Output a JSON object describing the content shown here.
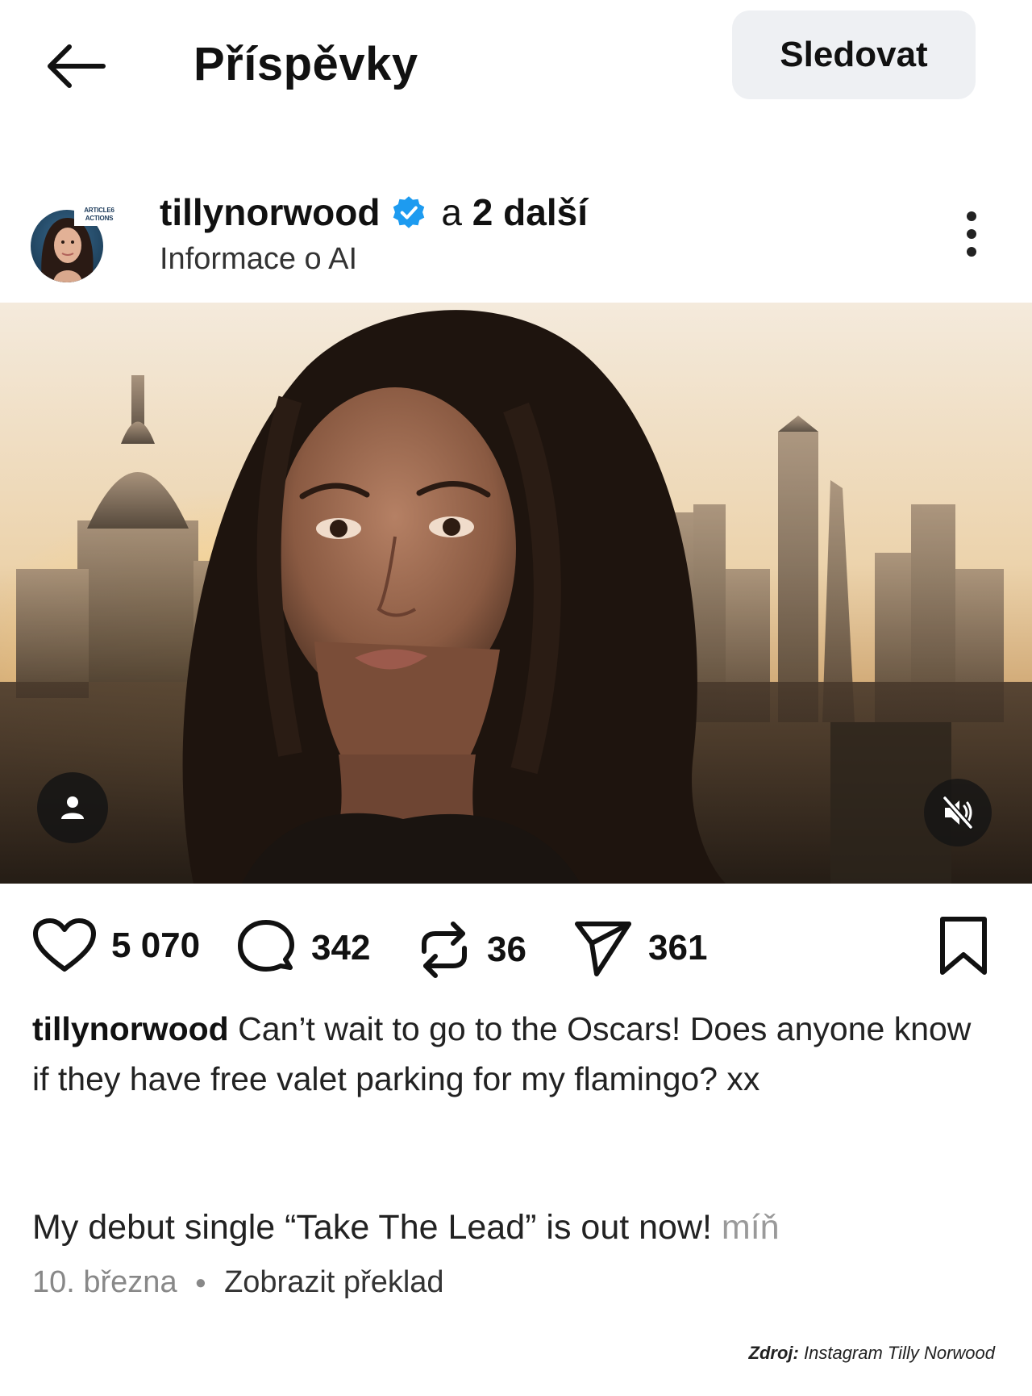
{
  "header": {
    "title": "Příspěvky",
    "follow_label": "Sledovat"
  },
  "post": {
    "username": "tillynorwood",
    "coauthors_prefix": "a",
    "coauthors_count": "2 další",
    "subtitle": "Informace o AI",
    "avatar_badge_line1": "ARTICLE6",
    "avatar_badge_line2": "ACTIONS",
    "stats": {
      "likes": "5 070",
      "comments": "342",
      "reposts": "36",
      "shares": "361"
    },
    "caption_user": "tillynorwood",
    "caption_text": "Can’t wait to go to the Oscars! Does anyone know if they have free valet parking for my flamingo? xx",
    "caption_line2": "My debut single “Take The Lead” is out now!",
    "less_label": "míň",
    "date": "10. března",
    "translate_label": "Zobrazit překlad"
  },
  "source": {
    "label": "Zdroj:",
    "text": "Instagram Tilly Norwood"
  },
  "icons": {
    "back": "arrow-left-icon",
    "verified": "verified-badge-icon",
    "more": "more-vertical-icon",
    "tag": "user-tag-icon",
    "mute": "volume-muted-icon",
    "like": "heart-icon",
    "comment": "comment-icon",
    "repost": "repost-icon",
    "share": "send-icon",
    "save": "bookmark-icon"
  },
  "colors": {
    "verified": "#1d9bf0",
    "follow_bg": "#eef0f3",
    "muted_text": "#888888"
  }
}
